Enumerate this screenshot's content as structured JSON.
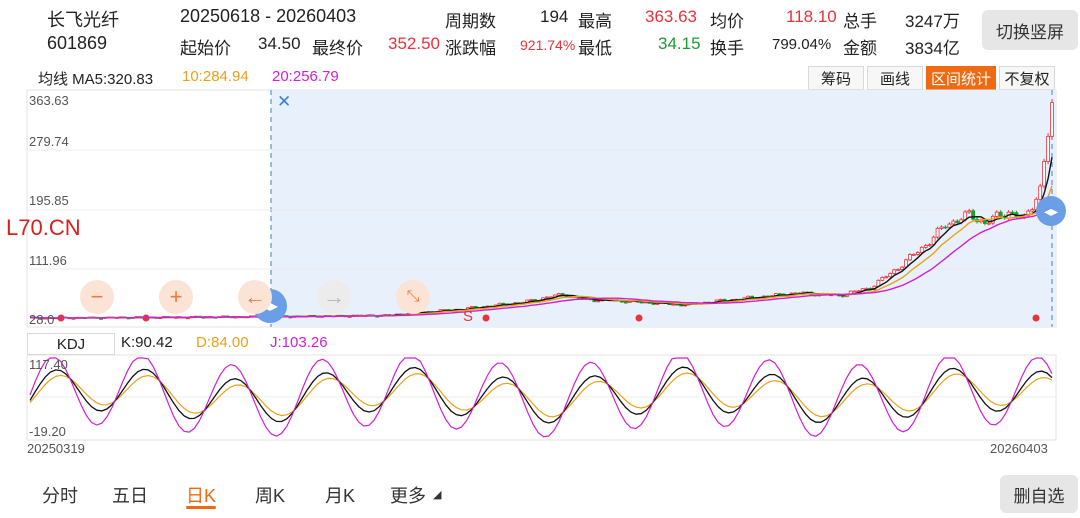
{
  "header": {
    "stock_name": "长飞光纤",
    "stock_code": "601869",
    "date_range": "20250618  - 20260403",
    "period_label": "周期数",
    "period_value": "194",
    "high_label": "最高",
    "high_value": "363.63",
    "avg_label": "均价",
    "avg_value": "118.10",
    "total_vol_label": "总手",
    "total_vol_value": "3247万",
    "start_label": "起始价",
    "start_value": "34.50",
    "end_label": "最终价",
    "end_value": "352.50",
    "change_label": "涨跌幅",
    "change_value": "921.74%",
    "low_label": "最低",
    "low_value": "34.15",
    "turnover_label": "换手",
    "turnover_value": "799.04%",
    "amount_label": "金额",
    "amount_value": "3834亿",
    "switch_button": "切换竖屏"
  },
  "ma_bar": {
    "ma5": "均线 MA5:320.83",
    "ma10": "10:284.94",
    "ma20": "20:256.79"
  },
  "toolbar": {
    "chips": "筹码",
    "draw": "画线",
    "range_stats": "区间统计",
    "no_adjust": "不复权"
  },
  "main_chart": {
    "y_ticks": [
      "363.63",
      "279.74",
      "195.85",
      "111.96",
      "28.0"
    ],
    "watermark": "L70.CN",
    "marker_s": "S"
  },
  "kdj": {
    "button": "KDJ",
    "k": "K:90.42",
    "d": "D:84.00",
    "j": "J:103.26",
    "y_top": "117.40",
    "y_bottom": "-19.20"
  },
  "x_axis": {
    "start": "20250319",
    "end": "20260403"
  },
  "tabs": [
    "分时",
    "五日",
    "日K",
    "周K",
    "月K",
    "更多"
  ],
  "delete_button": "删自选",
  "colors": {
    "up": "#e8333a",
    "down": "#1a9f34",
    "accent": "#f06a12",
    "ma5": "#111111",
    "ma10": "#e8a21a",
    "ma20": "#d21fd2",
    "selection": "#e7f0fb"
  }
}
